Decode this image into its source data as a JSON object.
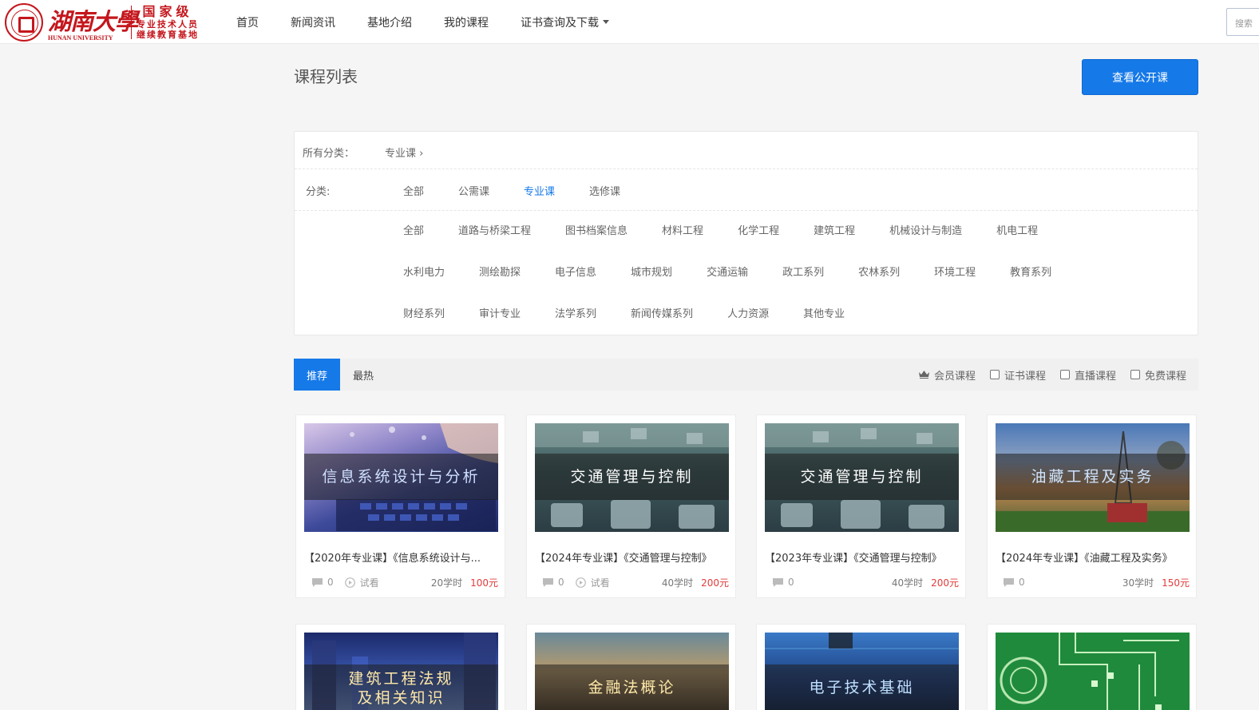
{
  "header": {
    "logo": {
      "cn_name": "湖南大學",
      "en_name": "HUNAN UNIVERSITY",
      "cert_line1": "国家级",
      "cert_line2": "专业技术人员",
      "cert_line3": "继续教育基地"
    },
    "nav": [
      {
        "label": "首页"
      },
      {
        "label": "新闻资讯"
      },
      {
        "label": "基地介绍"
      },
      {
        "label": "我的课程"
      },
      {
        "label": "证书查询及下载",
        "has_dropdown": true
      }
    ],
    "search": {
      "placeholder": "搜索"
    }
  },
  "page": {
    "title": "课程列表",
    "open_course_button": "查看公开课"
  },
  "filter": {
    "breadcrumb_label": "所有分类：",
    "breadcrumb_value": "专业课 ›",
    "category_label": "分类:",
    "categories": [
      {
        "label": "全部"
      },
      {
        "label": "公需课"
      },
      {
        "label": "专业课",
        "active": true
      },
      {
        "label": "选修课"
      }
    ],
    "subcategories": [
      {
        "label": "全部",
        "active": true
      },
      {
        "label": "道路与桥梁工程"
      },
      {
        "label": "图书档案信息"
      },
      {
        "label": "材料工程"
      },
      {
        "label": "化学工程"
      },
      {
        "label": "建筑工程"
      },
      {
        "label": "机械设计与制造"
      },
      {
        "label": "机电工程"
      },
      {
        "label": "水利电力"
      },
      {
        "label": "测绘勘探"
      },
      {
        "label": "电子信息"
      },
      {
        "label": "城市规划"
      },
      {
        "label": "交通运输"
      },
      {
        "label": "政工系列"
      },
      {
        "label": "农林系列"
      },
      {
        "label": "环境工程"
      },
      {
        "label": "教育系列"
      },
      {
        "label": "财经系列"
      },
      {
        "label": "审计专业"
      },
      {
        "label": "法学系列"
      },
      {
        "label": "新闻传媒系列"
      },
      {
        "label": "人力资源"
      },
      {
        "label": "其他专业"
      }
    ]
  },
  "tabs": {
    "recommend": "推荐",
    "hot": "最热"
  },
  "options": {
    "member": "会员课程",
    "certificate": "证书课程",
    "live": "直播课程",
    "free": "免费课程"
  },
  "courses": [
    {
      "banner": "信息系统设计与分析",
      "title": "【2020年专业课】《信息系统设计与...",
      "comments": "0",
      "trial": "试看",
      "hours": "20学时",
      "price": "100元",
      "theme": "keyboard"
    },
    {
      "banner": "交通管理与控制",
      "title": "【2024年专业课】《交通管理与控制》",
      "comments": "0",
      "trial": "试看",
      "hours": "40学时",
      "price": "200元",
      "theme": "traffic"
    },
    {
      "banner": "交通管理与控制",
      "title": "【2023年专业课】《交通管理与控制》",
      "comments": "0",
      "hours": "40学时",
      "price": "200元",
      "theme": "traffic"
    },
    {
      "banner": "油藏工程及实务",
      "title": "【2024年专业课】《油藏工程及实务》",
      "comments": "0",
      "hours": "30学时",
      "price": "150元",
      "theme": "oil"
    },
    {
      "banner_line1": "建筑工程法规",
      "banner_line2": "及相关知识",
      "theme": "city"
    },
    {
      "banner": "金融法概论",
      "theme": "finance"
    },
    {
      "banner": "电子技术基础",
      "theme": "circuit"
    },
    {
      "banner": "",
      "theme": "pcb"
    }
  ],
  "colors": {
    "accent": "#1679e8",
    "price": "#e23b3b",
    "brand_red": "#c4161c"
  }
}
